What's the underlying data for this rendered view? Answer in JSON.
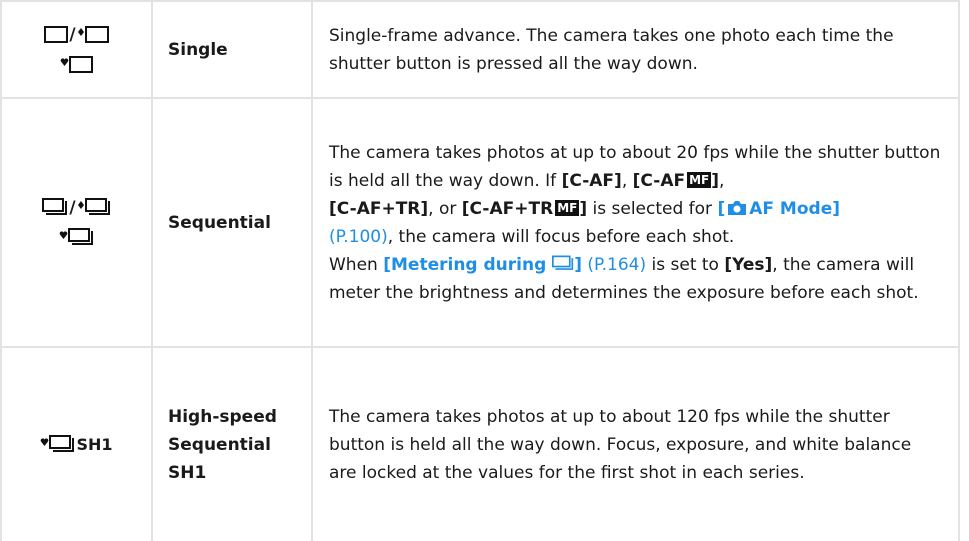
{
  "rows": [
    {
      "icon_top_sep": "/",
      "name": "Single",
      "desc": "Single-frame advance. The camera takes one photo each time the shutter button is pressed all the way down."
    },
    {
      "icon_top_sep": "/",
      "name": "Sequential",
      "p1": "The camera takes photos at up to about 20 fps while the shutter button is held all the way down. If ",
      "caf": "[C-AF]",
      "comma1": ", ",
      "caf_mf_pre": "[C-AF",
      "caf_mf_badge": "MF",
      "caf_mf_post": "]",
      "comma2": ",",
      "caftr": "[C-AF+TR]",
      "or": ", or ",
      "caftr_mf_pre": "[C-AF+TR",
      "caftr_mf_badge": "MF",
      "caftr_mf_post": "]",
      "selected_for": " is selected for ",
      "af_mode_link": "AF Mode]",
      "af_mode_bracket": "[",
      "page_ref1": "(P.100)",
      "p1_end": ", the camera will focus before each shot.",
      "metering_link_pre": "[Metering during ",
      "metering_link_post": "]",
      "page_ref2": "(P.164)",
      "is_set_to": " is set to ",
      "yes": "[Yes]",
      "p2_end": ", the camera will meter the brightness and determines the exposure before each shot."
    },
    {
      "icon_label": "SH1",
      "name": "High-speed Sequential SH1",
      "desc": "The camera takes photos at up to about 120 fps while the shutter button is held all the way down. Focus, exposure, and white balance are locked at the values for the first shot in each series."
    }
  ]
}
